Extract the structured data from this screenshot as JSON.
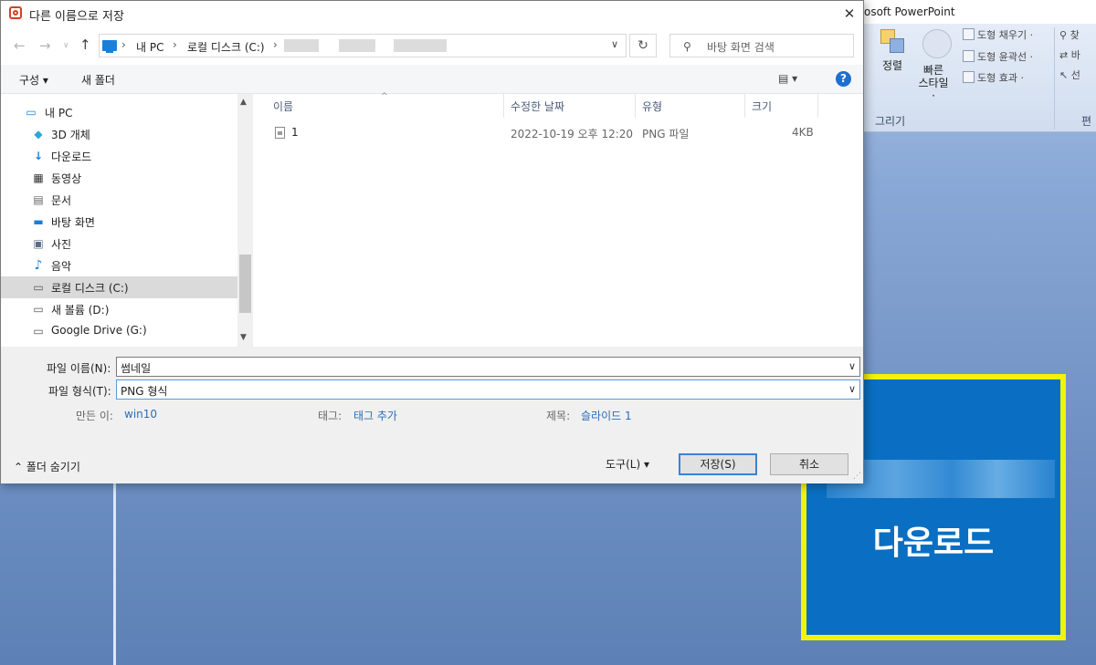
{
  "ppt": {
    "title": "osoft PowerPoint",
    "ribbon": {
      "fill_label": "도형 채우기 ·",
      "outline_label": "도형 윤곽선 ·",
      "effect_label": "도형 효과 ·",
      "arrange_label": "정렬",
      "quickstyle_label": "빠른\n스타일 ·",
      "group_draw": "그리기",
      "group_edit": "편",
      "find_label": "찾",
      "replace_label": "바",
      "select_label": "선"
    },
    "slide_text": "다운로드",
    "colors": {
      "slide_bg": "#0a6fc2",
      "slide_border": "#f2f20a"
    }
  },
  "dialog": {
    "title": "다른 이름으로 저장",
    "close": "✕",
    "address": {
      "items": [
        "내 PC",
        "로컬 디스크 (C:)"
      ]
    },
    "search_placeholder": "바탕 화면 검색",
    "toolbar": {
      "organize": "구성 ▾",
      "new_folder": "새 폴더",
      "view": "▤ ▾",
      "help": "?"
    },
    "sidebar": [
      {
        "label": "내 PC",
        "icon": "pc-icon"
      },
      {
        "label": "3D 개체",
        "icon": "cube-icon"
      },
      {
        "label": "다운로드",
        "icon": "download-icon"
      },
      {
        "label": "동영상",
        "icon": "video-icon"
      },
      {
        "label": "문서",
        "icon": "document-icon"
      },
      {
        "label": "바탕 화면",
        "icon": "desktop-icon"
      },
      {
        "label": "사진",
        "icon": "picture-icon"
      },
      {
        "label": "음악",
        "icon": "music-icon"
      },
      {
        "label": "로컬 디스크 (C:)",
        "icon": "drive-icon",
        "selected": true
      },
      {
        "label": "새 볼륨 (D:)",
        "icon": "drive-icon"
      },
      {
        "label": "Google Drive (G:)",
        "icon": "drive-icon"
      }
    ],
    "columns": [
      "이름",
      "수정한 날짜",
      "유형",
      "크기"
    ],
    "files": [
      {
        "name": "1",
        "date": "2022-10-19 오후 12:20",
        "type": "PNG 파일",
        "size": "4KB"
      }
    ],
    "filename_label": "파일 이름(N):",
    "filename_value": "썸네일",
    "filetype_label": "파일 형식(T):",
    "filetype_value": "PNG 형식",
    "meta": {
      "author_label": "만든 이:",
      "author_value": "win10",
      "tags_label": "태그:",
      "tags_value": "태그 추가",
      "title_label": "제목:",
      "title_value": "슬라이드 1"
    },
    "hide_folders": "⌃ 폴더 숨기기",
    "tools": "도구(L)   ▾",
    "save": "저장(S)",
    "cancel": "취소"
  }
}
